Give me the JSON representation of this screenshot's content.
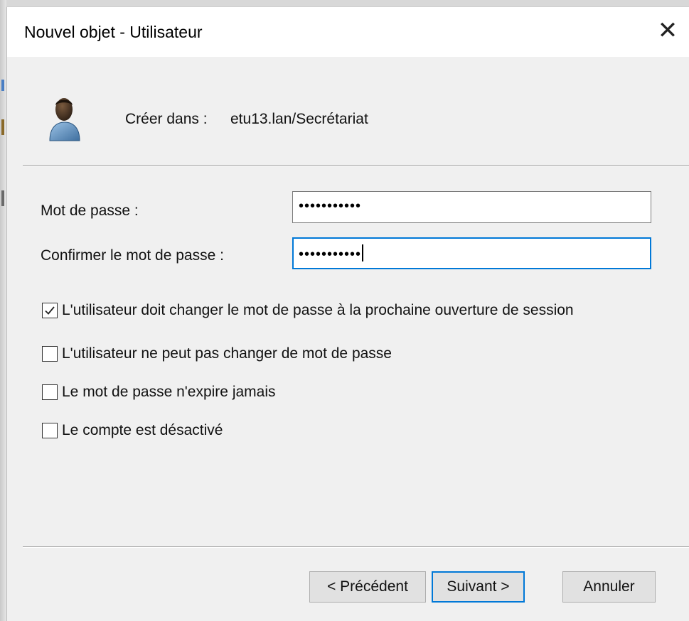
{
  "window": {
    "title": "Nouvel objet - Utilisateur",
    "close_glyph": "✕"
  },
  "header": {
    "icon": "user-icon",
    "create_in_label": "Créer dans :",
    "create_in_value": "etu13.lan/Secrétariat"
  },
  "form": {
    "password_label": "Mot de passe :",
    "password_value": "•••••••••••",
    "confirm_label": "Confirmer le mot de passe :",
    "confirm_value": "•••••••••••"
  },
  "options": [
    {
      "label": "L'utilisateur doit changer le mot de passe à la prochaine ouverture de session",
      "checked": true
    },
    {
      "label": "L'utilisateur ne peut pas changer de mot de passe",
      "checked": false
    },
    {
      "label": "Le mot de passe n'expire jamais",
      "checked": false
    },
    {
      "label": "Le compte est désactivé",
      "checked": false
    }
  ],
  "buttons": {
    "previous": "< Précédent",
    "next": "Suivant >",
    "cancel": "Annuler"
  },
  "colors": {
    "focus_accent": "#0078d7",
    "dialog_bg": "#f0f0f0",
    "titlebar_bg": "#ffffff"
  }
}
